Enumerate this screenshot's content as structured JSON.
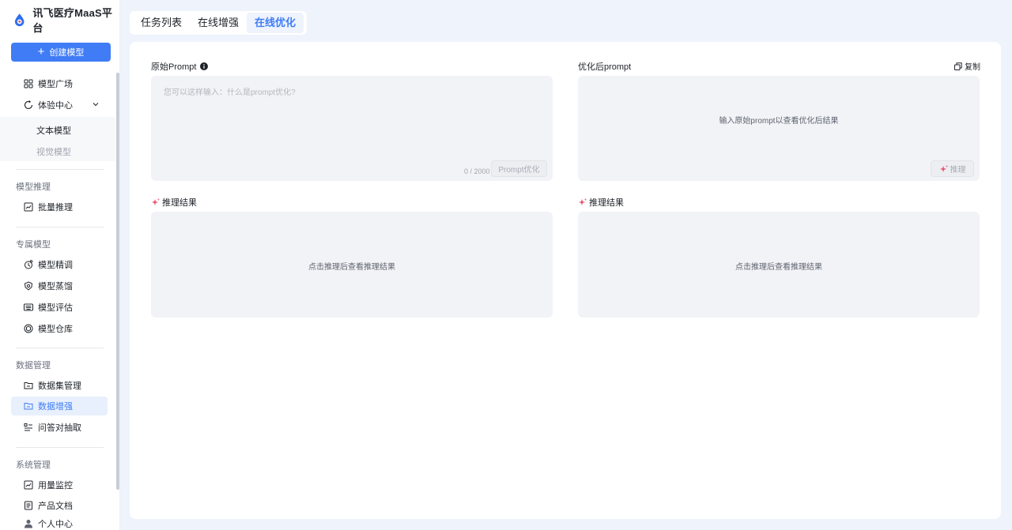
{
  "brand": {
    "name": "讯飞医疗MaaS平台",
    "accent": "#3f7cf5"
  },
  "sidebar": {
    "create_button": "创建模型",
    "items": {
      "model_plaza": "模型广场",
      "experience_center": "体验中心",
      "text_model": "文本模型",
      "vision_model": "视觉模型",
      "batch_inference": "批量推理",
      "fine_tune": "模型精调",
      "distill": "模型蒸馏",
      "evaluate": "模型评估",
      "repository": "模型仓库",
      "dataset_mgmt": "数据集管理",
      "data_augment": "数据增强",
      "qa_extract": "问答对抽取",
      "usage_monitor": "用量监控",
      "product_docs": "产品文档",
      "personal_center": "个人中心"
    },
    "sections": {
      "inference": "模型推理",
      "dedicated": "专属模型",
      "data": "数据管理",
      "system": "系统管理"
    }
  },
  "tabs": [
    "任务列表",
    "在线增强",
    "在线优化"
  ],
  "left_panel": {
    "label": "原始Prompt",
    "placeholder": "您可以这样输入：什么是prompt优化?",
    "counter": "0 / 2000",
    "optimize_button": "Prompt优化",
    "result_label": "推理结果",
    "result_empty": "点击推理后查看推理结果"
  },
  "right_panel": {
    "label": "优化后prompt",
    "copy": "复制",
    "empty": "输入原始prompt以查看优化后结果",
    "infer_button": "推理",
    "result_label": "推理结果",
    "result_empty": "点击推理后查看推理结果"
  }
}
